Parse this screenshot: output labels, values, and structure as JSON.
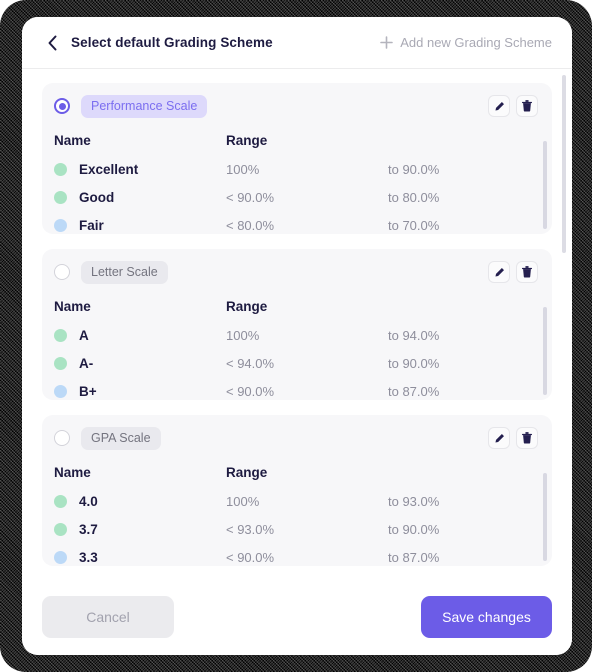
{
  "header": {
    "back_icon": "chevron-left-icon",
    "title": "Select default Grading Scheme",
    "add_icon": "plus-icon",
    "add_label": "Add new Grading Scheme"
  },
  "table_headers": {
    "name": "Name",
    "range": "Range"
  },
  "colors": {
    "accent": "#6c5ce7",
    "badge_active_bg": "#ddd9fb",
    "badge_active_text": "#7b6ef0",
    "badge_bg": "#e9e9ee",
    "badge_text": "#74747f",
    "card_bg": "#f7f7f9",
    "title_text": "#1e1b41",
    "muted_text": "#8e8e9c",
    "dot_green": "#a9e3c3",
    "dot_blue": "#bcd9f7"
  },
  "schemes": [
    {
      "name": "Performance Scale",
      "selected": true,
      "edit_icon": "pencil-icon",
      "delete_icon": "trash-icon",
      "rows": [
        {
          "dot": "#a9e3c3",
          "name": "Excellent",
          "from": "100%",
          "to": "to 90.0%"
        },
        {
          "dot": "#a9e3c3",
          "name": "Good",
          "from": "< 90.0%",
          "to": "to 80.0%"
        },
        {
          "dot": "#bcd9f7",
          "name": "Fair",
          "from": "< 80.0%",
          "to": "to 70.0%"
        }
      ]
    },
    {
      "name": "Letter Scale",
      "selected": false,
      "edit_icon": "pencil-icon",
      "delete_icon": "trash-icon",
      "rows": [
        {
          "dot": "#a9e3c3",
          "name": "A",
          "from": "100%",
          "to": "to 94.0%"
        },
        {
          "dot": "#a9e3c3",
          "name": "A-",
          "from": "< 94.0%",
          "to": "to 90.0%"
        },
        {
          "dot": "#bcd9f7",
          "name": "B+",
          "from": "< 90.0%",
          "to": "to 87.0%"
        }
      ]
    },
    {
      "name": "GPA Scale",
      "selected": false,
      "edit_icon": "pencil-icon",
      "delete_icon": "trash-icon",
      "rows": [
        {
          "dot": "#a9e3c3",
          "name": "4.0",
          "from": "100%",
          "to": "to 93.0%"
        },
        {
          "dot": "#a9e3c3",
          "name": "3.7",
          "from": "< 93.0%",
          "to": "to 90.0%"
        },
        {
          "dot": "#bcd9f7",
          "name": "3.3",
          "from": "< 90.0%",
          "to": "to 87.0%"
        }
      ]
    }
  ],
  "footer": {
    "cancel_label": "Cancel",
    "save_label": "Save changes"
  }
}
